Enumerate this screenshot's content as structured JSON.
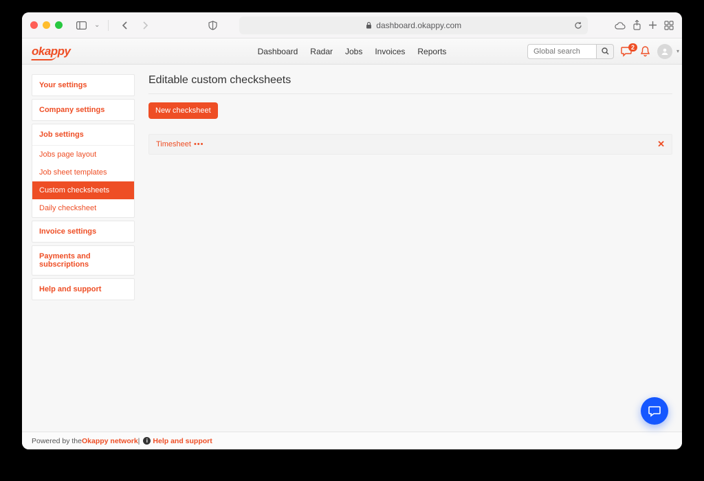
{
  "browser": {
    "url": "dashboard.okappy.com"
  },
  "brand": "okappy",
  "nav": [
    "Dashboard",
    "Radar",
    "Jobs",
    "Invoices",
    "Reports"
  ],
  "search": {
    "placeholder": "Global search"
  },
  "notif": {
    "chat_badge": "2"
  },
  "sidebar": [
    {
      "label": "Your settings",
      "items": []
    },
    {
      "label": "Company settings",
      "items": []
    },
    {
      "label": "Job settings",
      "open": true,
      "items": [
        {
          "label": "Jobs page layout",
          "active": false
        },
        {
          "label": "Job sheet templates",
          "active": false
        },
        {
          "label": "Custom checksheets",
          "active": true
        },
        {
          "label": "Daily checksheet",
          "active": false
        }
      ]
    },
    {
      "label": "Invoice settings",
      "items": []
    },
    {
      "label": "Payments and subscriptions",
      "items": []
    },
    {
      "label": "Help and support",
      "items": []
    }
  ],
  "page": {
    "title": "Editable custom checksheets",
    "new_btn": "New checksheet",
    "rows": [
      {
        "name": "Timesheet"
      }
    ]
  },
  "footer": {
    "prefix": "Powered by the ",
    "network": "Okappy network",
    "sep": " | ",
    "help": "Help and support"
  }
}
